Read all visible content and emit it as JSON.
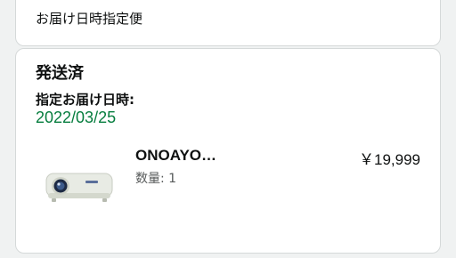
{
  "delivery_type": "お届け日時指定便",
  "shipment": {
    "status": "発送済",
    "date_label": "指定お届け日時:",
    "date_value": "2022/03/25"
  },
  "item": {
    "name": "ONOAYO…",
    "quantity": "数量: 1",
    "price": "￥19,999",
    "thumbnail": "projector-image"
  },
  "colors": {
    "date_green": "#067d3e",
    "border": "#d5d9d9",
    "background": "#f0f2f2"
  }
}
